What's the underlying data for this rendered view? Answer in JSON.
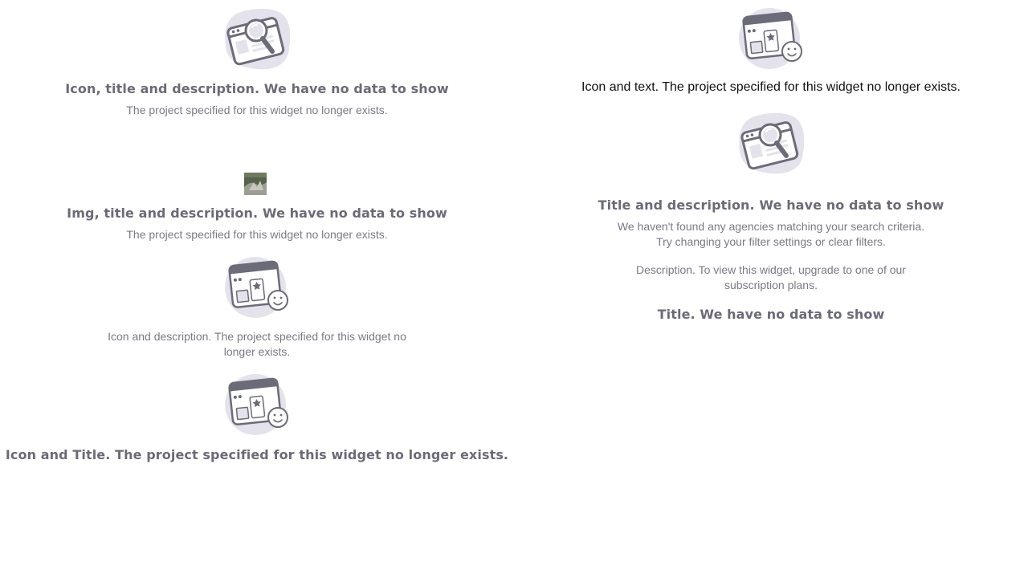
{
  "left": {
    "block1": {
      "icon": "search-browser-icon",
      "title": "Icon, title and description. We have no data to show",
      "description": "The project specified for this widget no longer exists."
    },
    "block2": {
      "image": "thumbnail-image",
      "title": "Img, title and description. We have no data to show",
      "description": "The project specified for this widget no longer exists."
    },
    "block3": {
      "icon": "favorite-browser-icon",
      "description": "Icon and description. The project specified for this widget no longer exists."
    },
    "block4": {
      "icon": "favorite-browser-icon",
      "title": "Icon and Title. The project specified for this widget no longer exists."
    }
  },
  "right": {
    "block1": {
      "icon": "favorite-browser-icon",
      "text": "Icon and text. The project specified for this widget no longer exists."
    },
    "block2": {
      "icon": "search-browser-icon",
      "title": "Title and description. We have no data to show",
      "description_line1": "We haven't found any agencies matching your search criteria.",
      "description_line2": "Try changing your filter settings or clear filters."
    },
    "block3": {
      "description": "Description. To view this widget, upgrade to one of our subscription plans."
    },
    "block4": {
      "title": "Title. We have no data to show"
    }
  },
  "colors": {
    "title": "#6b6a78",
    "description": "#7a7986",
    "icon_dark": "#6c6b79",
    "icon_light": "#e4e3ec"
  }
}
